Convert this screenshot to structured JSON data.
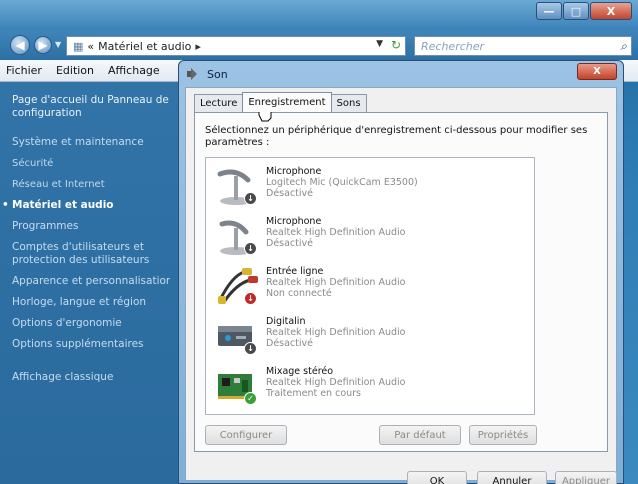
{
  "explorer": {
    "window_controls": [
      "—",
      "□",
      "X"
    ],
    "address": {
      "prefix": "«",
      "path": "Matériel et audio",
      "arrow": "▸"
    },
    "search_placeholder": "Rechercher",
    "menu": [
      "Fichier",
      "Edition",
      "Affichage"
    ],
    "sidebar": {
      "home": "Page d'accueil du Panneau de configuration",
      "items": [
        "Système et maintenance",
        "Sécurité",
        "Réseau et Internet",
        "Matériel et audio",
        "Programmes",
        "Comptes d'utilisateurs et protection des utilisateurs",
        "Apparence et personnalisation",
        "Horloge, langue et région",
        "Options d'ergonomie",
        "Options supplémentaires"
      ],
      "classic": "Affichage classique"
    }
  },
  "dialog": {
    "title": "Son",
    "close": "X",
    "tabs": [
      "Lecture",
      "Enregistrement",
      "Sons"
    ],
    "instruction": "Sélectionnez un périphérique d'enregistrement ci-dessous pour modifier ses paramètres :",
    "devices": [
      {
        "name": "Microphone",
        "driver": "Logitech Mic (QuickCam E3500)",
        "status": "Désactivé"
      },
      {
        "name": "Microphone",
        "driver": "Realtek High Definition Audio",
        "status": "Désactivé"
      },
      {
        "name": "Entrée ligne",
        "driver": "Realtek High Definition Audio",
        "status": "Non connecté"
      },
      {
        "name": "Digitalin",
        "driver": "Realtek High Definition Audio",
        "status": "Désactivé"
      },
      {
        "name": "Mixage stéréo",
        "driver": "Realtek High Definition Audio",
        "status": "Traitement en cours"
      }
    ],
    "buttons": {
      "configure": "Configurer",
      "default": "Par défaut",
      "properties": "Propriétés",
      "ok": "OK",
      "cancel": "Annuler",
      "apply": "Appliquer"
    }
  }
}
